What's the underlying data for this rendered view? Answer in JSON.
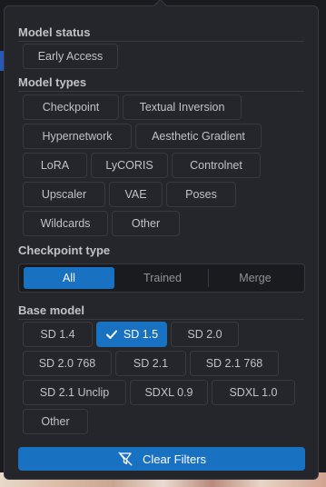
{
  "colors": {
    "accent": "#1971c2",
    "panel_bg": "#25262b",
    "border": "#373a40",
    "text": "#c1c2c5"
  },
  "model_status": {
    "title": "Model status",
    "chips": [
      "Early Access"
    ]
  },
  "model_types": {
    "title": "Model types",
    "chips": [
      "Checkpoint",
      "Textual Inversion",
      "Hypernetwork",
      "Aesthetic Gradient",
      "LoRA",
      "LyCORIS",
      "Controlnet",
      "Upscaler",
      "VAE",
      "Poses",
      "Wildcards",
      "Other"
    ]
  },
  "checkpoint_type": {
    "title": "Checkpoint type",
    "options": [
      "All",
      "Trained",
      "Merge"
    ],
    "selected": "All"
  },
  "base_model": {
    "title": "Base model",
    "chips": [
      "SD 1.4",
      "SD 1.5",
      "SD 2.0",
      "SD 2.0 768",
      "SD 2.1",
      "SD 2.1 768",
      "SD 2.1 Unclip",
      "SDXL 0.9",
      "SDXL 1.0",
      "Other"
    ],
    "selected": [
      "SD 1.5"
    ]
  },
  "clear_button": {
    "label": "Clear Filters",
    "icon": "filter-off-icon"
  }
}
